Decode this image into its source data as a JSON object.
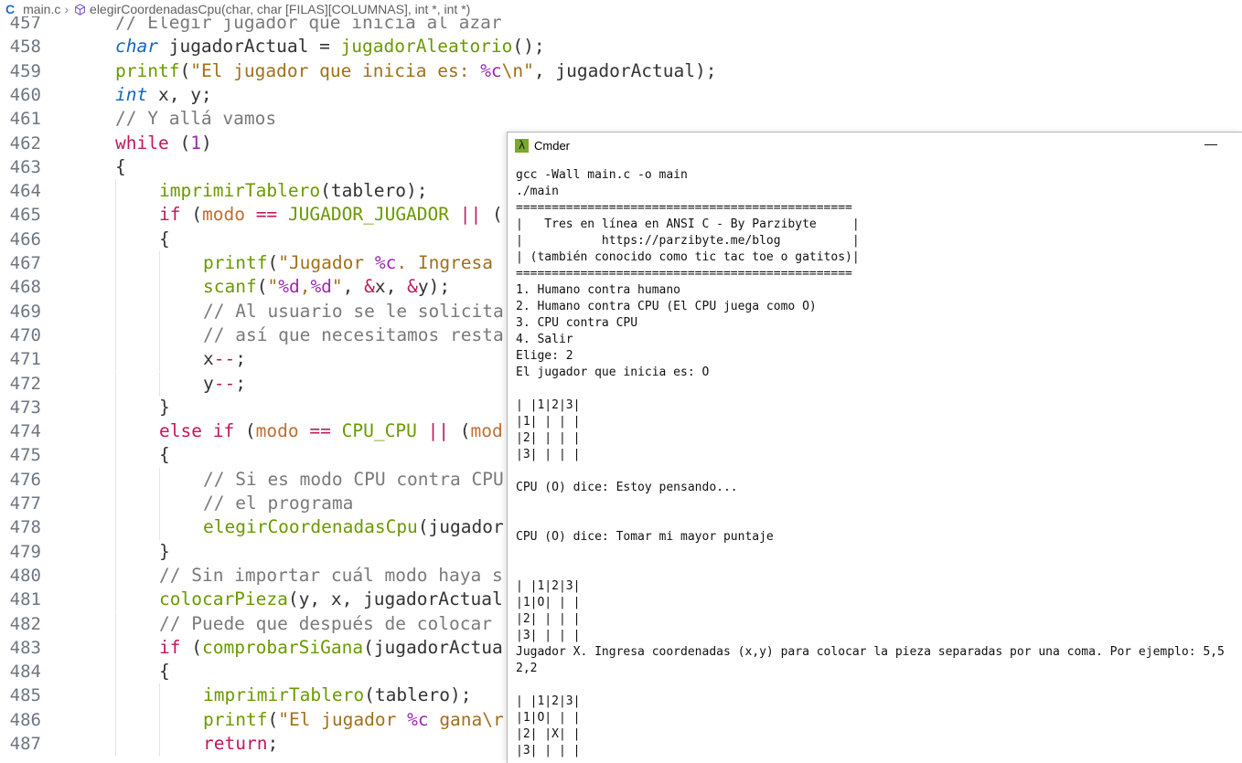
{
  "breadcrumb": {
    "file": "main.c",
    "symbol": "elegirCoordenadasCpu(char, char [FILAS][COLUMNAS], int *, int *)"
  },
  "editor": {
    "lines": [
      {
        "n": "457",
        "indent": 1,
        "tokens": [
          {
            "c": "cm",
            "t": "// Elegir jugador que inicia al azar"
          }
        ]
      },
      {
        "n": "458",
        "indent": 1,
        "tokens": [
          {
            "c": "ty",
            "t": "char"
          },
          {
            "c": "",
            "t": " jugadorActual = "
          },
          {
            "c": "fn",
            "t": "jugadorAleatorio"
          },
          {
            "c": "",
            "t": "();"
          }
        ]
      },
      {
        "n": "459",
        "indent": 1,
        "tokens": [
          {
            "c": "fn",
            "t": "printf"
          },
          {
            "c": "",
            "t": "("
          },
          {
            "c": "str",
            "t": "\"El jugador que inicia es: "
          },
          {
            "c": "num",
            "t": "%c"
          },
          {
            "c": "str",
            "t": "\\n\""
          },
          {
            "c": "",
            "t": ", jugadorActual);"
          }
        ]
      },
      {
        "n": "460",
        "indent": 1,
        "tokens": [
          {
            "c": "ty",
            "t": "int"
          },
          {
            "c": "",
            "t": " x, y;"
          }
        ]
      },
      {
        "n": "461",
        "indent": 1,
        "tokens": [
          {
            "c": "cm",
            "t": "// Y allá vamos"
          }
        ]
      },
      {
        "n": "462",
        "indent": 1,
        "tokens": [
          {
            "c": "kw",
            "t": "while"
          },
          {
            "c": "",
            "t": " ("
          },
          {
            "c": "num",
            "t": "1"
          },
          {
            "c": "",
            "t": ")"
          }
        ]
      },
      {
        "n": "463",
        "indent": 1,
        "tokens": [
          {
            "c": "",
            "t": "{"
          }
        ]
      },
      {
        "n": "464",
        "indent": 2,
        "tokens": [
          {
            "c": "fn",
            "t": "imprimirTablero"
          },
          {
            "c": "",
            "t": "(tablero);"
          }
        ]
      },
      {
        "n": "465",
        "indent": 2,
        "tokens": [
          {
            "c": "kw",
            "t": "if"
          },
          {
            "c": "",
            "t": " ("
          },
          {
            "c": "vr2",
            "t": "modo"
          },
          {
            "c": "",
            "t": " "
          },
          {
            "c": "op",
            "t": "=="
          },
          {
            "c": "",
            "t": " "
          },
          {
            "c": "mac",
            "t": "JUGADOR_JUGADOR"
          },
          {
            "c": "",
            "t": " "
          },
          {
            "c": "op",
            "t": "||"
          },
          {
            "c": "",
            "t": " ("
          }
        ]
      },
      {
        "n": "466",
        "indent": 2,
        "tokens": [
          {
            "c": "",
            "t": "{"
          }
        ]
      },
      {
        "n": "467",
        "indent": 3,
        "tokens": [
          {
            "c": "fn",
            "t": "printf"
          },
          {
            "c": "",
            "t": "("
          },
          {
            "c": "str",
            "t": "\"Jugador "
          },
          {
            "c": "num",
            "t": "%c"
          },
          {
            "c": "str",
            "t": ". Ingresa"
          }
        ]
      },
      {
        "n": "468",
        "indent": 3,
        "tokens": [
          {
            "c": "fn",
            "t": "scanf"
          },
          {
            "c": "",
            "t": "("
          },
          {
            "c": "str",
            "t": "\""
          },
          {
            "c": "num",
            "t": "%d"
          },
          {
            "c": "str",
            "t": ","
          },
          {
            "c": "num",
            "t": "%d"
          },
          {
            "c": "str",
            "t": "\""
          },
          {
            "c": "",
            "t": ", "
          },
          {
            "c": "op",
            "t": "&"
          },
          {
            "c": "",
            "t": "x, "
          },
          {
            "c": "op",
            "t": "&"
          },
          {
            "c": "",
            "t": "y);"
          }
        ]
      },
      {
        "n": "469",
        "indent": 3,
        "tokens": [
          {
            "c": "cm",
            "t": "// Al usuario se le solicita"
          }
        ]
      },
      {
        "n": "470",
        "indent": 3,
        "tokens": [
          {
            "c": "cm",
            "t": "// así que necesitamos resta"
          }
        ]
      },
      {
        "n": "471",
        "indent": 3,
        "tokens": [
          {
            "c": "",
            "t": "x"
          },
          {
            "c": "op",
            "t": "--"
          },
          {
            "c": "",
            "t": ";"
          }
        ]
      },
      {
        "n": "472",
        "indent": 3,
        "tokens": [
          {
            "c": "",
            "t": "y"
          },
          {
            "c": "op",
            "t": "--"
          },
          {
            "c": "",
            "t": ";"
          }
        ]
      },
      {
        "n": "473",
        "indent": 2,
        "tokens": [
          {
            "c": "",
            "t": "}"
          }
        ]
      },
      {
        "n": "474",
        "indent": 2,
        "tokens": [
          {
            "c": "kw",
            "t": "else if"
          },
          {
            "c": "",
            "t": " ("
          },
          {
            "c": "vr2",
            "t": "modo"
          },
          {
            "c": "",
            "t": " "
          },
          {
            "c": "op",
            "t": "=="
          },
          {
            "c": "",
            "t": " "
          },
          {
            "c": "mac",
            "t": "CPU_CPU"
          },
          {
            "c": "",
            "t": " "
          },
          {
            "c": "op",
            "t": "||"
          },
          {
            "c": "",
            "t": " ("
          },
          {
            "c": "vr2",
            "t": "mod"
          }
        ]
      },
      {
        "n": "475",
        "indent": 2,
        "tokens": [
          {
            "c": "",
            "t": "{"
          }
        ]
      },
      {
        "n": "476",
        "indent": 3,
        "tokens": [
          {
            "c": "cm",
            "t": "// Si es modo CPU contra CPU"
          }
        ]
      },
      {
        "n": "477",
        "indent": 3,
        "tokens": [
          {
            "c": "cm",
            "t": "// el programa"
          }
        ]
      },
      {
        "n": "478",
        "indent": 3,
        "tokens": [
          {
            "c": "fn",
            "t": "elegirCoordenadasCpu"
          },
          {
            "c": "",
            "t": "(jugador"
          }
        ]
      },
      {
        "n": "479",
        "indent": 2,
        "tokens": [
          {
            "c": "",
            "t": "}"
          }
        ]
      },
      {
        "n": "480",
        "indent": 2,
        "tokens": [
          {
            "c": "cm",
            "t": "// Sin importar cuál modo haya s"
          }
        ]
      },
      {
        "n": "481",
        "indent": 2,
        "tokens": [
          {
            "c": "fn",
            "t": "colocarPieza"
          },
          {
            "c": "",
            "t": "(y, x, jugadorActual"
          }
        ]
      },
      {
        "n": "482",
        "indent": 2,
        "tokens": [
          {
            "c": "cm",
            "t": "// Puede que después de colocar"
          }
        ]
      },
      {
        "n": "483",
        "indent": 2,
        "tokens": [
          {
            "c": "kw",
            "t": "if"
          },
          {
            "c": "",
            "t": " ("
          },
          {
            "c": "fn",
            "t": "comprobarSiGana"
          },
          {
            "c": "",
            "t": "(jugadorActua"
          }
        ]
      },
      {
        "n": "484",
        "indent": 2,
        "tokens": [
          {
            "c": "",
            "t": "{"
          }
        ]
      },
      {
        "n": "485",
        "indent": 3,
        "tokens": [
          {
            "c": "fn",
            "t": "imprimirTablero"
          },
          {
            "c": "",
            "t": "(tablero);"
          }
        ]
      },
      {
        "n": "486",
        "indent": 3,
        "tokens": [
          {
            "c": "fn",
            "t": "printf"
          },
          {
            "c": "",
            "t": "("
          },
          {
            "c": "str",
            "t": "\"El jugador "
          },
          {
            "c": "num",
            "t": "%c"
          },
          {
            "c": "str",
            "t": " gana\\r"
          }
        ]
      },
      {
        "n": "487",
        "indent": 3,
        "tokens": [
          {
            "c": "kw",
            "t": "return"
          },
          {
            "c": "",
            "t": ";"
          }
        ]
      }
    ]
  },
  "cmder": {
    "title": "Cmder",
    "minimize_label": "—",
    "output": "gcc -Wall main.c -o main\n./main\n===============================================\n|   Tres en línea en ANSI C - By Parzibyte     |\n|           https://parzibyte.me/blog          |\n| (también conocido como tic tac toe o gatitos)|\n===============================================\n1. Humano contra humano\n2. Humano contra CPU (El CPU juega como O)\n3. CPU contra CPU\n4. Salir\nElige: 2\nEl jugador que inicia es: O\n\n| |1|2|3|\n|1| | | |\n|2| | | |\n|3| | | |\n\nCPU (O) dice: Estoy pensando...\n\n\nCPU (O) dice: Tomar mi mayor puntaje\n\n\n| |1|2|3|\n|1|O| | |\n|2| | | |\n|3| | | |\nJugador X. Ingresa coordenadas (x,y) para colocar la pieza separadas por una coma. Por ejemplo: 5,5\n2,2\n\n| |1|2|3|\n|1|O| | |\n|2| |X| |\n|3| | | |"
  },
  "colors": {
    "keyword": "#c2185b",
    "type": "#1565c0",
    "function": "#6a9a00",
    "string": "#a0701a",
    "comment": "#7a7a7a",
    "cmder_icon": "#7aa82a"
  }
}
